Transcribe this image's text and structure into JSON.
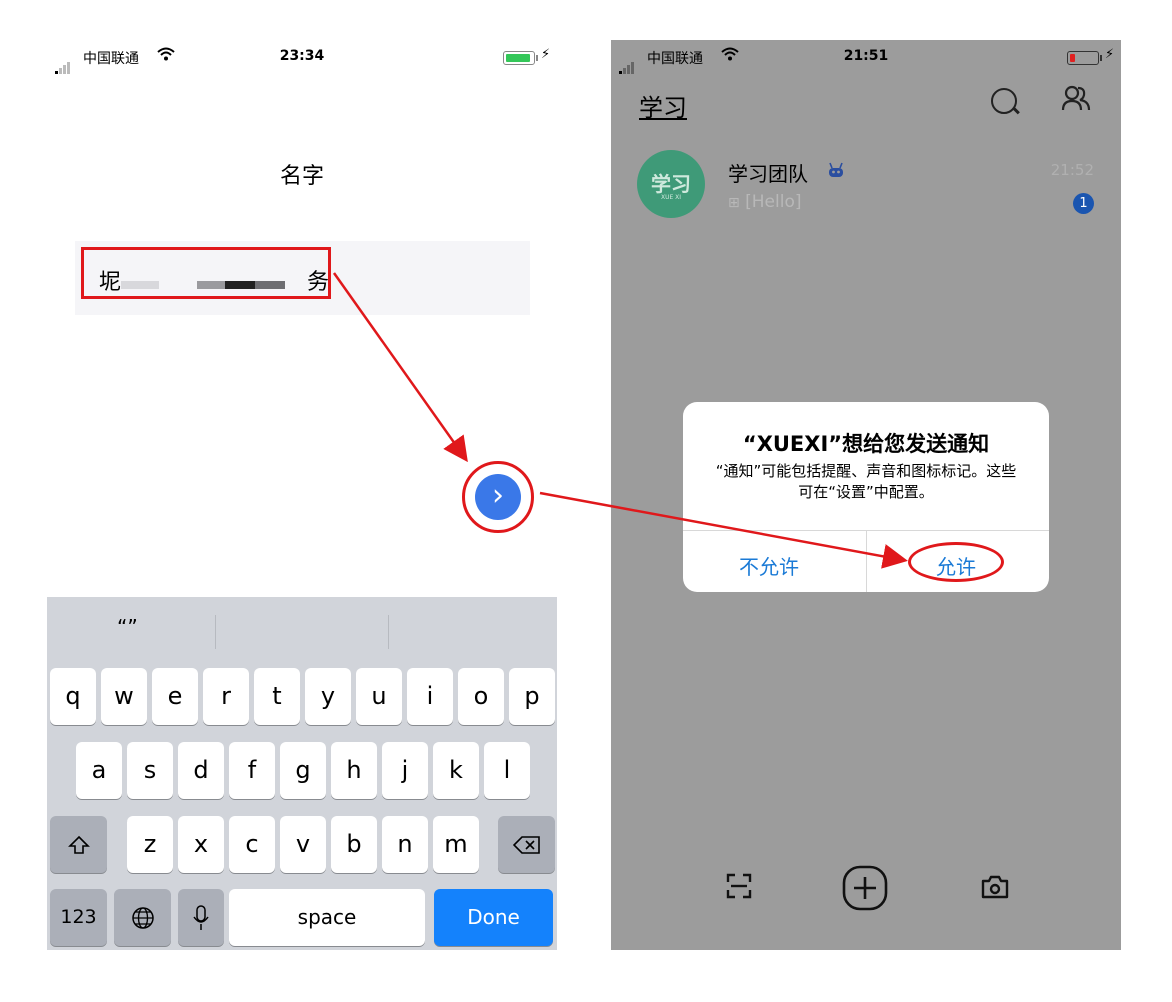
{
  "left_phone": {
    "status": {
      "carrier": "中国联通",
      "time": "23:34"
    },
    "page_title": "名字",
    "name_field": {
      "value_start": "坭",
      "value_end": "务"
    },
    "next_button_glyph": "›",
    "keyboard": {
      "suggestion": "“”",
      "row1": [
        "q",
        "w",
        "e",
        "r",
        "t",
        "y",
        "u",
        "i",
        "o",
        "p"
      ],
      "row2": [
        "a",
        "s",
        "d",
        "f",
        "g",
        "h",
        "j",
        "k",
        "l"
      ],
      "row3": [
        "z",
        "x",
        "c",
        "v",
        "b",
        "n",
        "m"
      ],
      "numbers_key": "123",
      "space_key": "space",
      "done_key": "Done"
    },
    "colors": {
      "accent": "#3a78e8",
      "done": "#1482fc",
      "battery": "#34c759"
    }
  },
  "right_phone": {
    "status": {
      "carrier": "中国联通",
      "time": "21:51"
    },
    "header_title": "学习",
    "chat": {
      "avatar_text": "学习",
      "avatar_subtext": "XUE XI",
      "name": "学习团队",
      "time": "21:52",
      "preview": "[Hello]",
      "unread": "1"
    },
    "dialog": {
      "title": "“XUEXI”想给您发送通知",
      "message": "“通知”可能包括提醒、声音和图标标记。这些可在“设置”中配置。",
      "deny_label": "不允许",
      "allow_label": "允许"
    },
    "colors": {
      "overlay": "#9c9c9c",
      "link": "#1a7ad6",
      "battery": "#e02020"
    }
  },
  "annotation_color": "#e0181b"
}
